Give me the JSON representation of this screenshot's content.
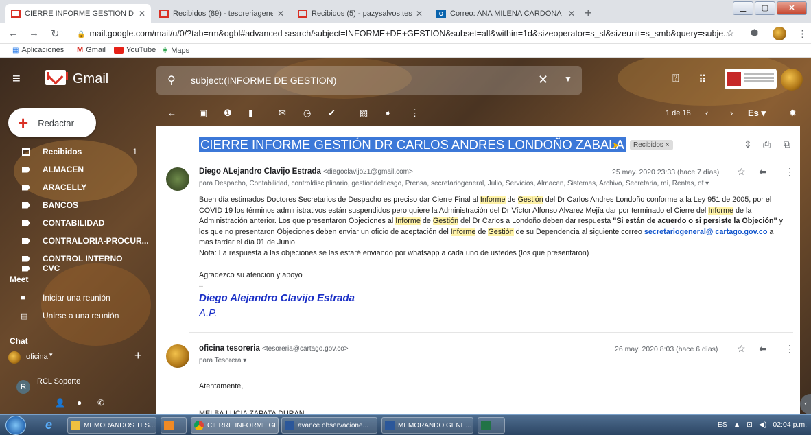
{
  "browser": {
    "tabs": [
      {
        "title": "CIERRE INFORME GESTIÓN DR C",
        "favicon": "gmail-icon",
        "active": true
      },
      {
        "title": "Recibidos (89) - tesoreriageneral",
        "favicon": "gmail-icon",
        "active": false
      },
      {
        "title": "Recibidos (5) - pazysalvos.tesore",
        "favicon": "gmail-icon",
        "active": false
      },
      {
        "title": "Correo: ANA MILENA CARDONA",
        "favicon": "outlook-icon",
        "active": false
      }
    ],
    "new_tab": "+",
    "url": "mail.google.com/mail/u/0/?tab=rm&ogbl#advanced-search/subject=INFORME+DE+GESTION&subset=all&within=1d&sizeoperator=s_sl&sizeunit=s_smb&query=subje...",
    "bookmarks": [
      "Aplicaciones",
      "Gmail",
      "YouTube",
      "Maps"
    ]
  },
  "gmail": {
    "brand": "Gmail",
    "search_value": "subject:(INFORME DE GESTION)",
    "compose_label": "Redactar",
    "nav": [
      {
        "label": "Recibidos",
        "count": "1",
        "icon": "inbox-icon"
      },
      {
        "label": "ALMACEN",
        "icon": "label-icon"
      },
      {
        "label": "ARACELLY",
        "icon": "label-icon"
      },
      {
        "label": "BANCOS",
        "icon": "label-icon"
      },
      {
        "label": "CONTABILIDAD",
        "icon": "label-icon"
      },
      {
        "label": "CONTRALORIA-PROCUR...",
        "icon": "label-icon"
      },
      {
        "label": "CONTROL INTERNO",
        "icon": "label-icon"
      },
      {
        "label": "CVC",
        "icon": "label-icon"
      }
    ],
    "meet": {
      "title": "Meet",
      "items": [
        {
          "label": "Iniciar una reunión",
          "icon": "video-icon"
        },
        {
          "label": "Unirse a una reunión",
          "icon": "keyboard-icon"
        }
      ]
    },
    "chat": {
      "title": "Chat",
      "user": "oficina",
      "contact": "RCL Soporte"
    },
    "toolbar": {
      "pagination": "1 de 18",
      "lang": "Es"
    }
  },
  "thread": {
    "subject": "CIERRE INFORME GESTIÓN DR CARLOS ANDRES LONDOÑO ZABALA",
    "label": "Recibidos ×",
    "messages": [
      {
        "sender": "Diego ALejandro Clavijo Estrada",
        "email": "<diegoclavijo21@gmail.com>",
        "date": "25 may. 2020 23:33 (hace 7 días)",
        "to": "para Despacho, Contabilidad, controldisciplinario, gestiondelriesgo, Prensa, secretariogeneral, Julio, Servicios, Almacen, Sistemas, Archivo, Secretaria, mí, Rentas, of",
        "p1a": "Buen día estimados Doctores Secretarios de Despacho es preciso dar Cierre Final al ",
        "informe": "Informe",
        "de": " de ",
        "gestion": "Gestión",
        "p1b": " del Dr Carlos Andres Londoño conforme a la Ley 951 de 2005, por el COVID 19 los términos administrativos están suspendidos pero quiere la Administración del Dr Víctor Alfonso Alvarez Mejía dar por terminado el Cierre del ",
        "p1c": " de la Administración anterior. Los que presentaron Objeciones al ",
        "p1d": " del Dr Carlos a Londoño deben dar respuesta ",
        "bold_q": "\"Si están de acuerdo o si persiste la Objeción\"",
        "p1e": " y ",
        "under_a": "los que no presentaron Objeciones deben enviar un oficio de aceptación del ",
        "under_b": " de su Dependencia",
        "p1f": " al siguiente correo ",
        "mail_link": "secretariogeneral@ cartago.gov.co",
        "p1g": " a mas tardar el día 01 de Junio",
        "note": "Nota: La respuesta a las objeciones se las estaré enviando por whatsapp a cada uno de ustedes (los que presentaron)",
        "thanks": "Agradezco su atención y apoyo",
        "dashes": "--",
        "sig_name": "Diego Alejandro Clavijo Estrada",
        "sig_role": "A.P."
      },
      {
        "sender": "oficina tesoreria",
        "email": "<tesoreria@cartago.gov.co>",
        "date": "26 may. 2020 8:03 (hace 6 días)",
        "to": "para Tesorera",
        "greeting": "Atentamente,",
        "sig_line": "MELBA LUCIA ZAPATA DURAN"
      }
    ]
  },
  "taskbar": {
    "items": [
      "MEMORANDOS TES...",
      "",
      "CIERRE INFORME GE...",
      "avance observacione...",
      "MEMORANDO GENE...",
      ""
    ],
    "lang": "ES",
    "time": "02:04 p.m."
  },
  "colors": {
    "gmail_red": "#d93025",
    "highlight": "#3c78d8",
    "link": "#1155cc",
    "signature": "#1a2fc6"
  }
}
